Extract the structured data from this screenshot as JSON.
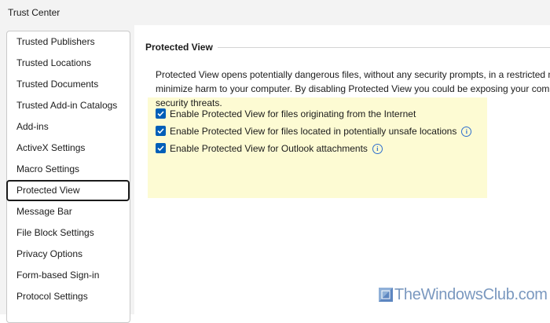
{
  "window": {
    "title": "Trust Center"
  },
  "sidebar": {
    "items": [
      {
        "label": "Trusted Publishers",
        "selected": false
      },
      {
        "label": "Trusted Locations",
        "selected": false
      },
      {
        "label": "Trusted Documents",
        "selected": false
      },
      {
        "label": "Trusted Add-in Catalogs",
        "selected": false
      },
      {
        "label": "Add-ins",
        "selected": false
      },
      {
        "label": "ActiveX Settings",
        "selected": false
      },
      {
        "label": "Macro Settings",
        "selected": false
      },
      {
        "label": "Protected View",
        "selected": true
      },
      {
        "label": "Message Bar",
        "selected": false
      },
      {
        "label": "File Block Settings",
        "selected": false
      },
      {
        "label": "Privacy Options",
        "selected": false
      },
      {
        "label": "Form-based Sign-in",
        "selected": false
      },
      {
        "label": "Protocol Settings",
        "selected": false
      }
    ]
  },
  "main": {
    "section_title": "Protected View",
    "description_lines": [
      "Protected View opens potentially dangerous files, without any security prompts, in a restricted m",
      "minimize harm to your computer. By disabling Protected View you could be exposing your com",
      "security threats."
    ],
    "options": [
      {
        "label": "Enable Protected View for files originating from the Internet",
        "checked": true,
        "info_icon": false
      },
      {
        "label": "Enable Protected View for files located in potentially unsafe locations",
        "checked": true,
        "info_icon": true
      },
      {
        "label": "Enable Protected View for Outlook attachments",
        "checked": true,
        "info_icon": true
      }
    ]
  },
  "watermark": {
    "text": "TheWindowsClub.com"
  },
  "colors": {
    "accent": "#005fb8",
    "highlight": "#fdfbd3",
    "info": "#2f6fce",
    "watermark": "#7a98bf"
  }
}
